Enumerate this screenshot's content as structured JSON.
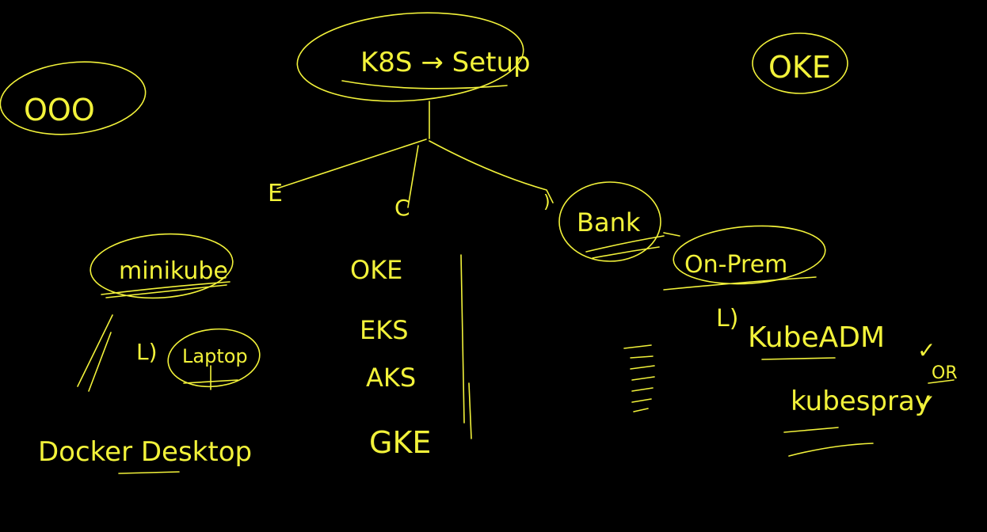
{
  "diagram": {
    "root": "K8S → Setup",
    "top_left_label": "OOO",
    "top_right_label": "OKE",
    "branches": {
      "left_mark": "E",
      "middle_mark": "C",
      "right_mark": ")"
    },
    "local": {
      "tool": "minikube",
      "target_arrow": "L)",
      "target": "Laptop",
      "alternative": "Docker Desktop"
    },
    "cloud": {
      "services": [
        "OKE",
        "EKS",
        "AKS",
        "GKE"
      ]
    },
    "onprem": {
      "org": "Bank",
      "env": "On-Prem",
      "arrow": "L)",
      "tool_primary": "KubeADM",
      "or_label": "OR",
      "tool_secondary": "kubespray",
      "check_mark": "✓"
    }
  },
  "colors": {
    "background": "#000000",
    "ink": "#f2f23a"
  }
}
